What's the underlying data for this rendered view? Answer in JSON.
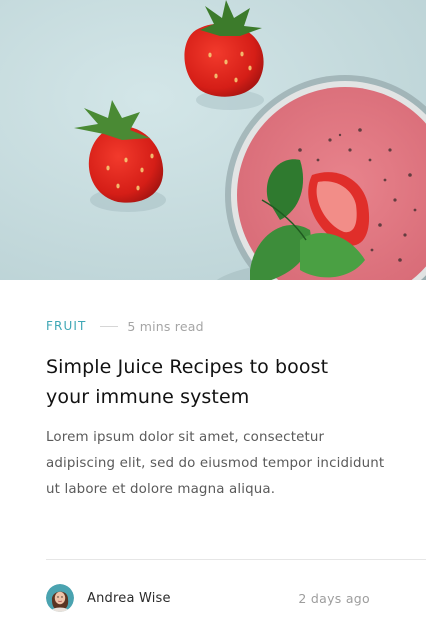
{
  "card": {
    "category": "FRUIT",
    "read_time": "5 mins read",
    "title": "Simple Juice Recipes to boost your immune system",
    "excerpt": "Lorem ipsum dolor sit amet, consectetur adipiscing elit, sed do eiusmod tempor incididunt ut labore et dolore magna aliqua.",
    "author": {
      "name": "Andrea Wise",
      "avatar_icon": "avatar-photo"
    },
    "posted": "2 days ago",
    "hero_image": "strawberry-smoothie-photo"
  },
  "colors": {
    "accent": "#3fa7b5",
    "hero_background": "#c8dde0",
    "title": "#121212",
    "body_text": "#5a5a5a",
    "muted": "#a5a5a5"
  }
}
